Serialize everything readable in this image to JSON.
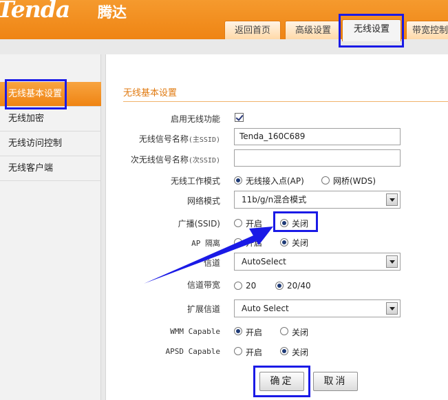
{
  "header": {
    "logo": "Tenda",
    "logo_cn": "腾达",
    "tabs": [
      "返回首页",
      "高级设置",
      "无线设置",
      "带宽控制"
    ],
    "active_tab": "无线设置"
  },
  "sidebar": {
    "items": [
      {
        "label": "无线基本设置",
        "active": true
      },
      {
        "label": "无线加密"
      },
      {
        "label": "无线访问控制"
      },
      {
        "label": "无线客户端"
      }
    ]
  },
  "form": {
    "title": "无线基本设置",
    "enable_wireless": {
      "label": "启用无线功能",
      "checked": true
    },
    "ssid_main": {
      "label": "无线信号名称",
      "sub": "(主SSID)",
      "value": "Tenda_160C689"
    },
    "ssid_second": {
      "label": "次无线信号名称",
      "sub": "(次SSID)",
      "value": ""
    },
    "work_mode": {
      "label": "无线工作模式",
      "options": [
        "无线接入点(AP)",
        "网桥(WDS)"
      ],
      "selected": "无线接入点(AP)"
    },
    "net_mode": {
      "label": "网络模式",
      "value": "11b/g/n混合模式"
    },
    "broadcast": {
      "label": "广播(SSID)",
      "options": [
        "开启",
        "关闭"
      ],
      "selected": "关闭"
    },
    "ap_isolation": {
      "label": "AP 隔离",
      "options": [
        "开启",
        "关闭"
      ],
      "selected": "关闭"
    },
    "channel": {
      "label": "信道",
      "value": "AutoSelect"
    },
    "bandwidth": {
      "label": "信道带宽",
      "options": [
        "20",
        "20/40"
      ],
      "selected": "20/40"
    },
    "ext_channel": {
      "label": "扩展信道",
      "value": "Auto Select"
    },
    "wmm": {
      "label": "WMM Capable",
      "options": [
        "开启",
        "关闭"
      ],
      "selected": "开启"
    },
    "apsd": {
      "label": "APSD Capable",
      "options": [
        "开启",
        "关闭"
      ],
      "selected": "关闭"
    },
    "ok_label": "确定",
    "cancel_label": "取消"
  },
  "colors": {
    "brand_orange": "#ef8413",
    "highlight_blue": "#1a1ae6"
  }
}
